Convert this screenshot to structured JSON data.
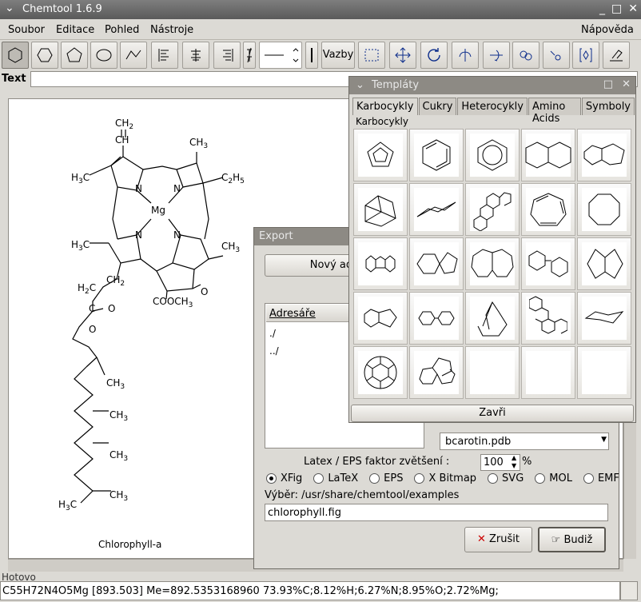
{
  "window": {
    "title": "Chemtool 1.6.9"
  },
  "menu": {
    "file": "Soubor",
    "edit": "Editace",
    "view": "Pohled",
    "tools": "Nástroje",
    "help": "Nápověda"
  },
  "toolbar": {
    "bonds_label": "Vazby",
    "text_label": "Text :"
  },
  "canvas": {
    "molecule_name": "Chlorophyll-a",
    "labels": [
      "CH2",
      "CH",
      "CH3",
      "H3C",
      "C2H5",
      "N",
      "N",
      "Mg",
      "N",
      "N",
      "H3C",
      "CH3",
      "H2C",
      "CH2",
      "C",
      "O",
      "O",
      "COOCH3",
      "O",
      "CH3",
      "CH3",
      "CH3",
      "H3C",
      "CH3"
    ]
  },
  "export": {
    "title": "Export",
    "new_dir_button": "Nový adresář",
    "dirs_header": "Adresáře",
    "dirs": [
      "./",
      "../"
    ],
    "file_item": "bcarotin.pdb",
    "scale_label": "Latex / EPS faktor zvětšení :",
    "scale_value": "100",
    "scale_unit": "%",
    "formats": [
      "XFig",
      "LaTeX",
      "EPS",
      "X Bitmap",
      "SVG",
      "MOL",
      "EMF"
    ],
    "selected_format": "XFig",
    "selection_label": "Výběr: /usr/share/chemtool/examples",
    "filename": "chlorophyll.fig",
    "cancel_label": "Zrušit",
    "ok_label": "Budiž"
  },
  "templates": {
    "title": "Templáty",
    "tabs": [
      "Karbocykly",
      "Cukry",
      "Heterocykly",
      "Amino Acids",
      "Symboly"
    ],
    "group_label": "Karbocykly",
    "close_label": "Zavři"
  },
  "status": {
    "text": "Hotovo",
    "formula": "C55H72N4O5Mg    [893.503]  Me=892.5353168960  73.93%C;8.12%H;6.27%N;8.95%O;2.72%Mg;"
  }
}
